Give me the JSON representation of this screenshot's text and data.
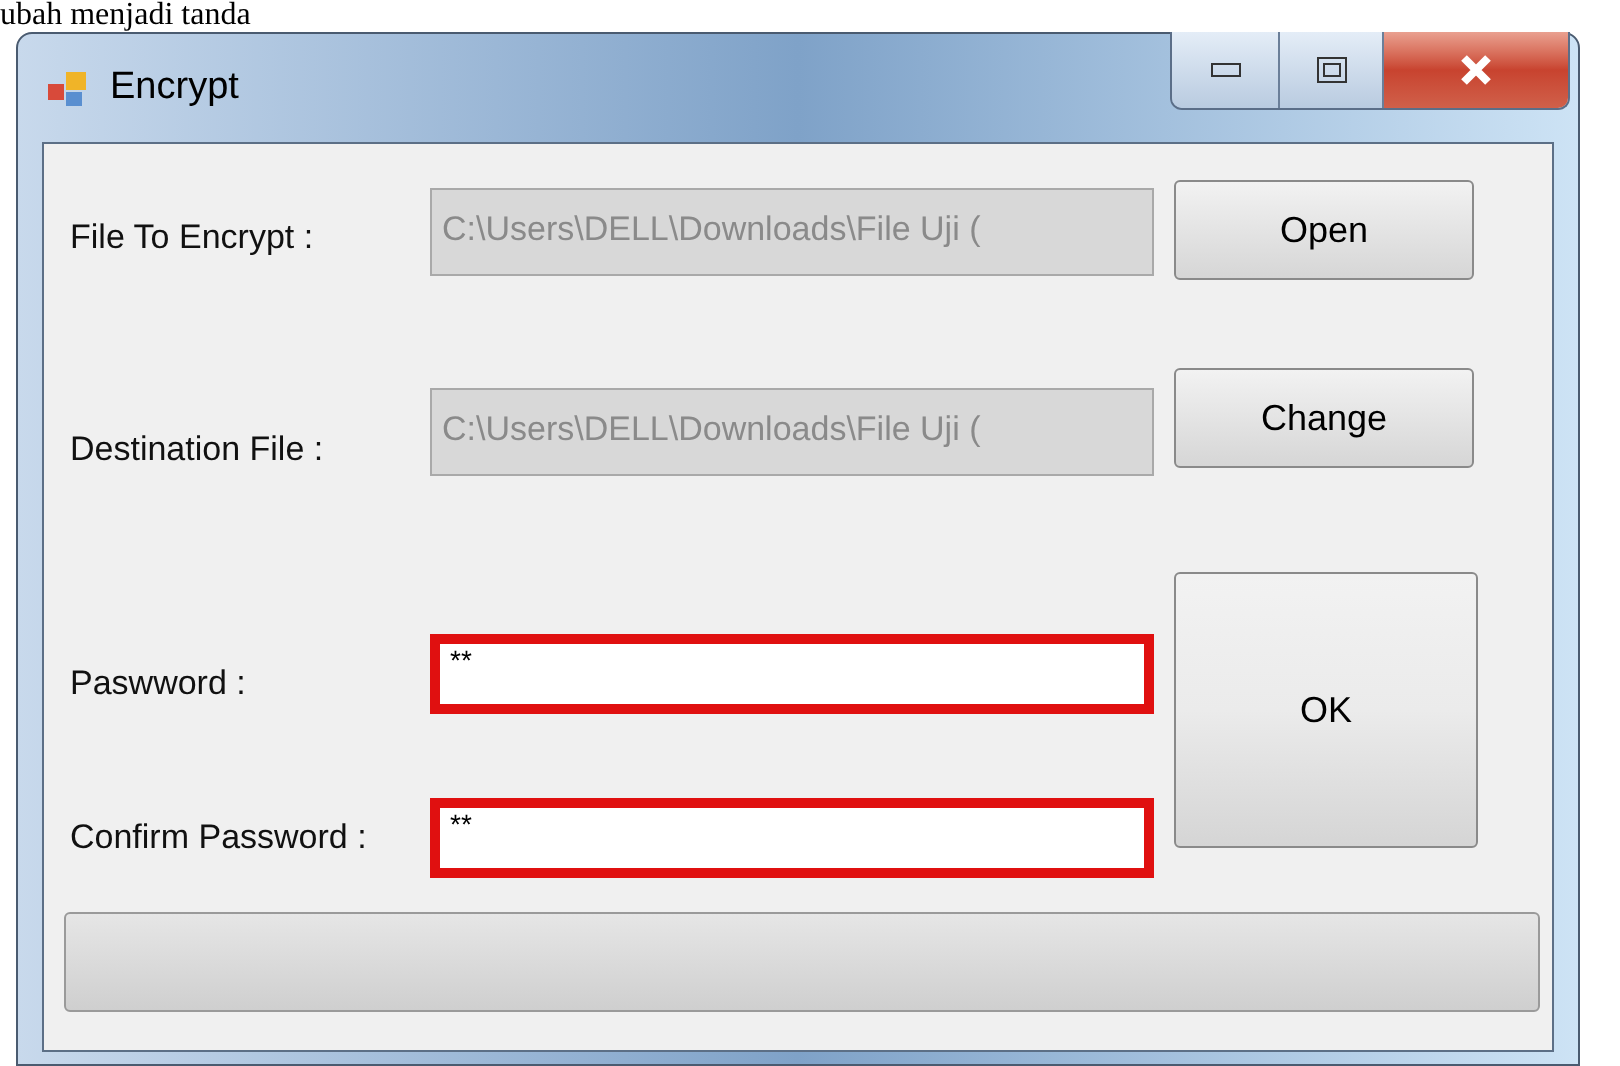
{
  "caption": "ubah menjadi tanda",
  "window": {
    "title": "Encrypt"
  },
  "rows": [
    {
      "label": "File To Encrypt :",
      "field": {
        "value": "C:\\Users\\DELL\\Downloads\\File Uji (",
        "disabled": true,
        "highlighted": false
      },
      "button": "Open"
    },
    {
      "label": "Destination File :",
      "field": {
        "value": "C:\\Users\\DELL\\Downloads\\File Uji (",
        "disabled": true,
        "highlighted": false
      },
      "button": "Change"
    },
    {
      "label": "Paswword :",
      "field": {
        "value": "**",
        "disabled": false,
        "highlighted": true
      }
    },
    {
      "label": "Confirm Password :",
      "field": {
        "value": "**",
        "disabled": false,
        "highlighted": true
      }
    }
  ],
  "ok_button": "OK",
  "progress": {
    "level": 0
  }
}
